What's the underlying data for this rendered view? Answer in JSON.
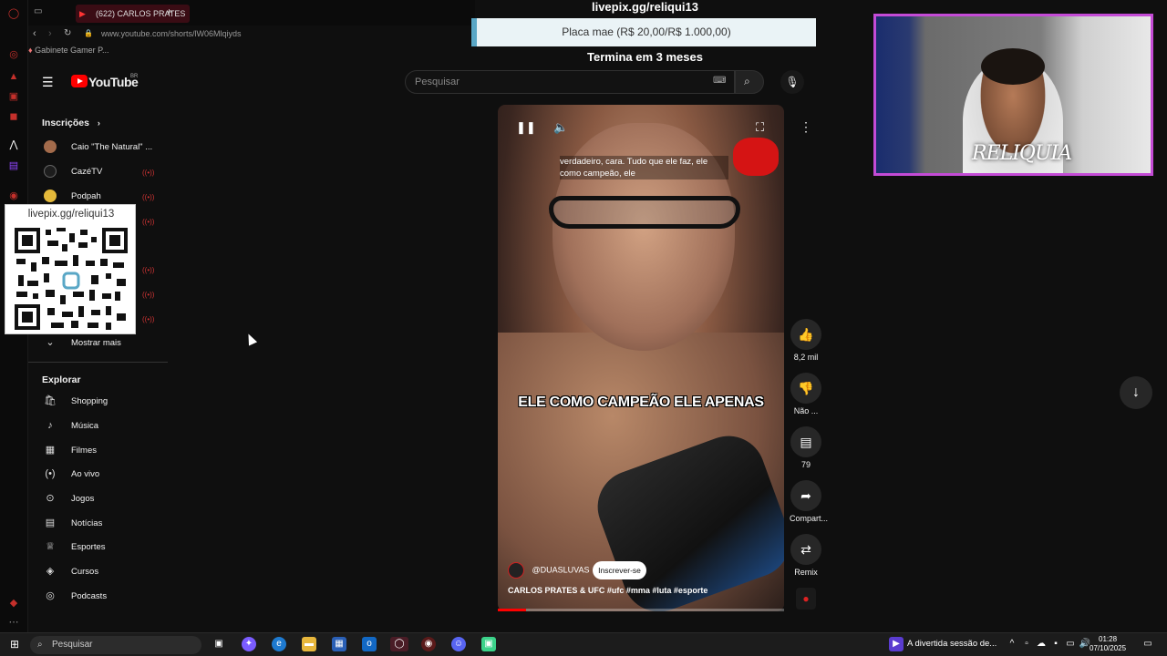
{
  "browser": {
    "tab_label": "(622) CARLOS PRATES",
    "url": "www.youtube.com/shorts/lW06Mlqiyds",
    "bookmark": "Gabinete Gamer P..."
  },
  "overlay": {
    "donation_link": "livepix.gg/reliqui13",
    "goal_text": "Placa mae (R$ 20,00/R$ 1.000,00)",
    "goal_ends": "Termina em 3 meses",
    "qr_label": "livepix.gg/reliqui13",
    "cam_name": "RELIQUIA"
  },
  "youtube": {
    "logo": "YouTube",
    "region": "BR",
    "search_placeholder": "Pesquisar"
  },
  "sidebar": {
    "subscriptions_title": "Inscrições",
    "subscriptions": [
      {
        "label": "Caio \"The Natural\" ..."
      },
      {
        "label": "CazéTV"
      },
      {
        "label": "Podpah"
      }
    ],
    "show_more": "Mostrar mais",
    "explore_title": "Explorar",
    "explore": [
      {
        "label": "Shopping",
        "icon": "shopping-bag-icon"
      },
      {
        "label": "Música",
        "icon": "music-note-icon"
      },
      {
        "label": "Filmes",
        "icon": "film-icon"
      },
      {
        "label": "Ao vivo",
        "icon": "live-icon"
      },
      {
        "label": "Jogos",
        "icon": "gamepad-icon"
      },
      {
        "label": "Notícias",
        "icon": "news-icon"
      },
      {
        "label": "Esportes",
        "icon": "trophy-icon"
      },
      {
        "label": "Cursos",
        "icon": "graduation-cap-icon"
      },
      {
        "label": "Podcasts",
        "icon": "podcast-icon"
      }
    ]
  },
  "short": {
    "caption_top": "verdadeiro, cara. Tudo que ele faz, ele como campeão, ele",
    "caption_main": "ELE COMO CAMPEÃO ELE APENAS",
    "channel": "@DUASLUVAS",
    "subscribe_label": "Inscrever-se",
    "title": "CARLOS PRATES & UFC #ufc #mma #luta #esporte",
    "progress": 0.1,
    "likes": "8,2 mil",
    "dislike_label": "Não ...",
    "comments": "79",
    "share_label": "Compart...",
    "remix_label": "Remix"
  },
  "taskbar": {
    "search_placeholder": "Pesquisar",
    "notification": "A divertida sessão de...",
    "time": "01:28",
    "date": "07/10/2025"
  }
}
